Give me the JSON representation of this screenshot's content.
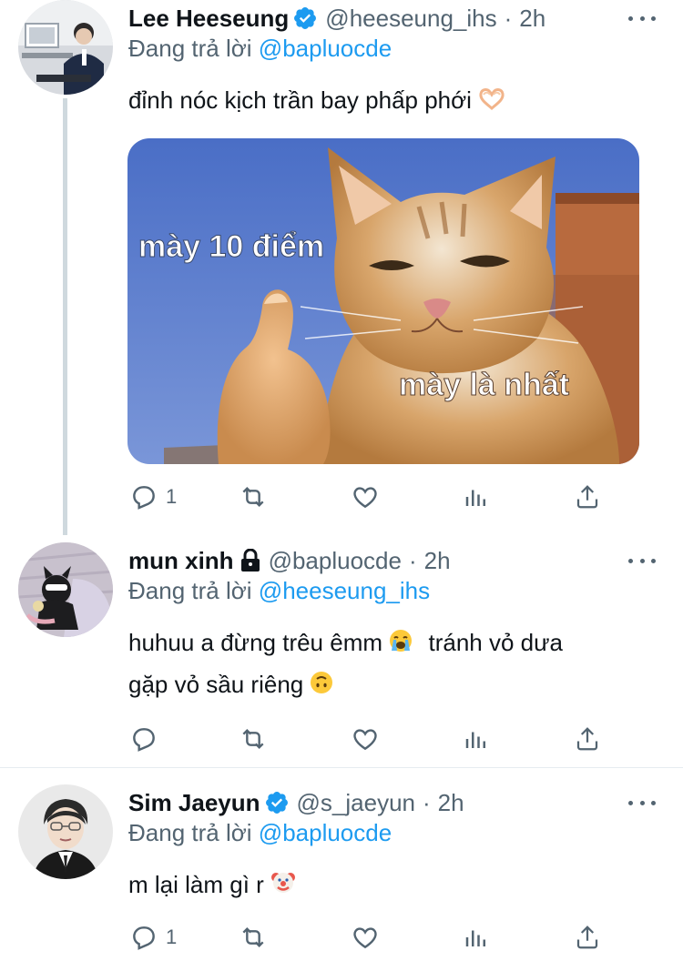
{
  "tweets": [
    {
      "name": "Lee Heeseung",
      "verified": true,
      "handle": "@heeseung_ihs",
      "dot": "·",
      "time": "2h",
      "reply_prefix": "Đang trả lời",
      "reply_to": "@bapluocde",
      "text": "đỉnh nóc kịch trần bay phấp phới",
      "emoji": "heart-hands",
      "media": {
        "caption_top": "mày 10 điểm",
        "caption_bottom": "mày là nhất"
      },
      "reply_count": "1"
    },
    {
      "name": "mun xinh",
      "locked": true,
      "handle": "@bapluocde",
      "dot": "·",
      "time": "2h",
      "reply_prefix": "Đang trả lời",
      "reply_to": "@heeseung_ihs",
      "text_line1_a": "huhuu a đừng trêu êmm",
      "text_line1_b": "tránh vỏ dưa",
      "text_line2": "gặp vỏ sầu riêng",
      "reply_count": ""
    },
    {
      "name": "Sim Jaeyun",
      "verified": true,
      "handle": "@s_jaeyun",
      "dot": "·",
      "time": "2h",
      "reply_prefix": "Đang trả lời",
      "reply_to": "@bapluocde",
      "text": "m lại làm gì r",
      "reply_count": "1"
    }
  ],
  "colors": {
    "accent": "#1d9bf0",
    "muted": "#536471",
    "text": "#0f1419"
  }
}
